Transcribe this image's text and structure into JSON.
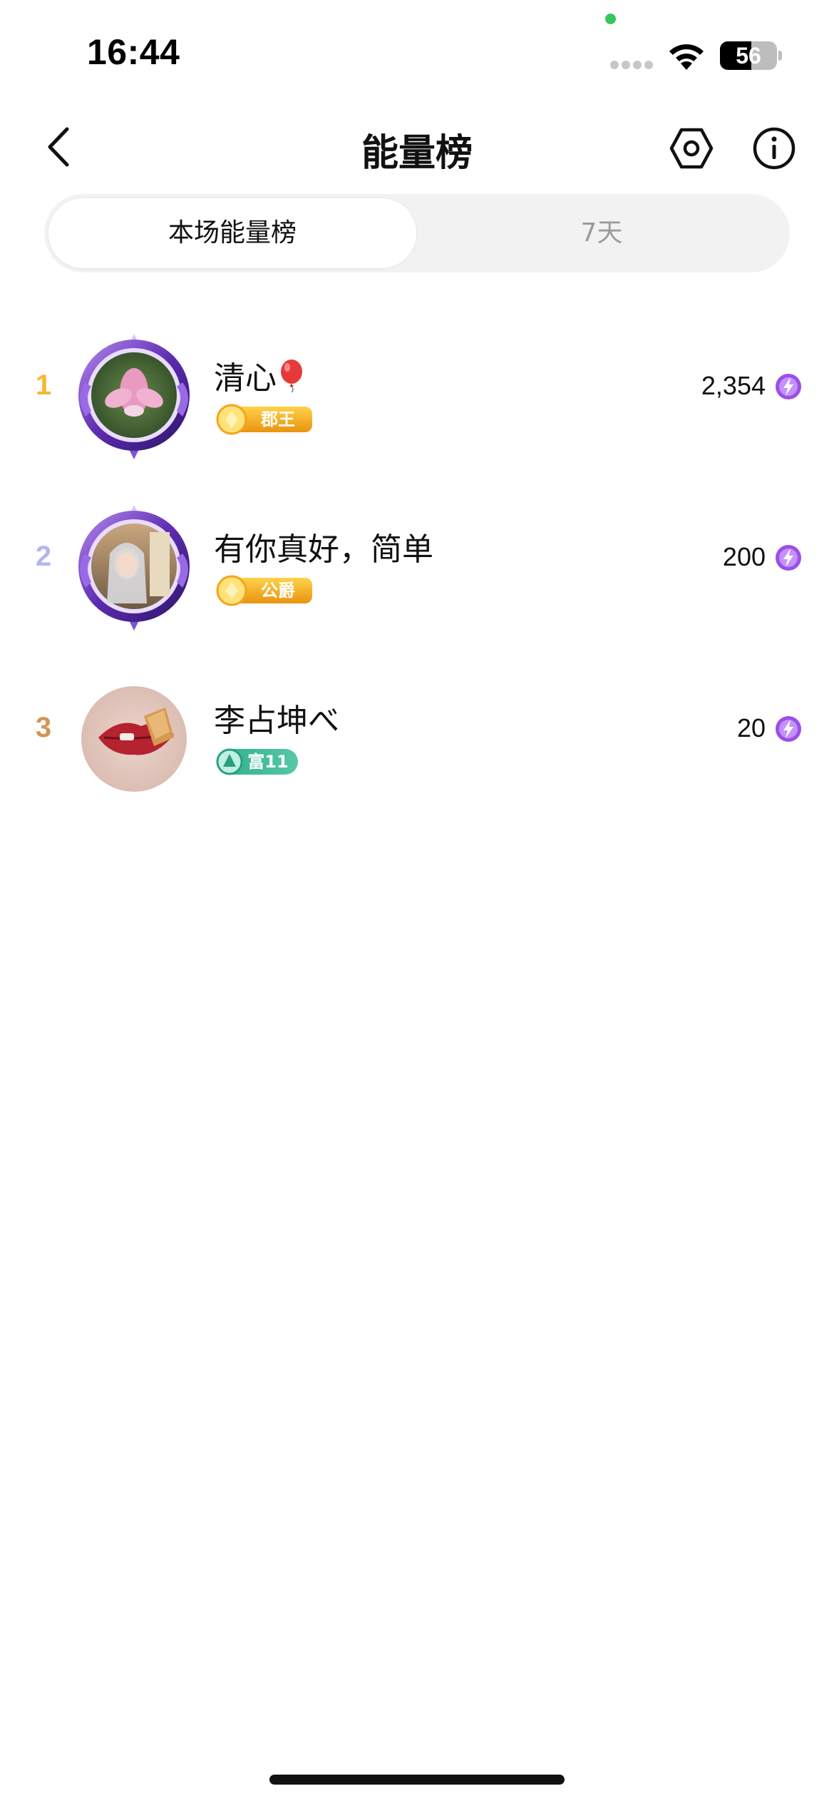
{
  "status_bar": {
    "time": "16:44",
    "battery": "56"
  },
  "nav": {
    "title": "能量榜",
    "back_icon": "chevron-left-icon",
    "settings_icon": "hexagon-settings-icon",
    "info_icon": "info-circle-icon"
  },
  "tabs": [
    {
      "label": "本场能量榜",
      "active": true
    },
    {
      "label": "7天",
      "active": false
    }
  ],
  "ranking": [
    {
      "rank": "1",
      "rank_color": "#f5b731",
      "name": "清心",
      "name_emoji": "balloon-icon",
      "badge": {
        "text": "郡王",
        "type": "gold"
      },
      "score": "2,354",
      "avatar": "lotus-avatar"
    },
    {
      "rank": "2",
      "rank_color": "#b3b6ee",
      "name": "有你真好，简单",
      "badge": {
        "text": "公爵",
        "type": "gold"
      },
      "score": "200",
      "avatar": "woman-photo-avatar"
    },
    {
      "rank": "3",
      "rank_color": "#d49456",
      "name": "李占坤べ",
      "badge": {
        "text": "富11",
        "type": "teal"
      },
      "score": "20",
      "avatar": "lips-photo-avatar"
    }
  ],
  "colors": {
    "energy_purple": "#8a3fe0",
    "gold_badge": "#f2a81d",
    "teal_badge": "#2bb39a",
    "frame_purple": "#6a3fc4"
  }
}
